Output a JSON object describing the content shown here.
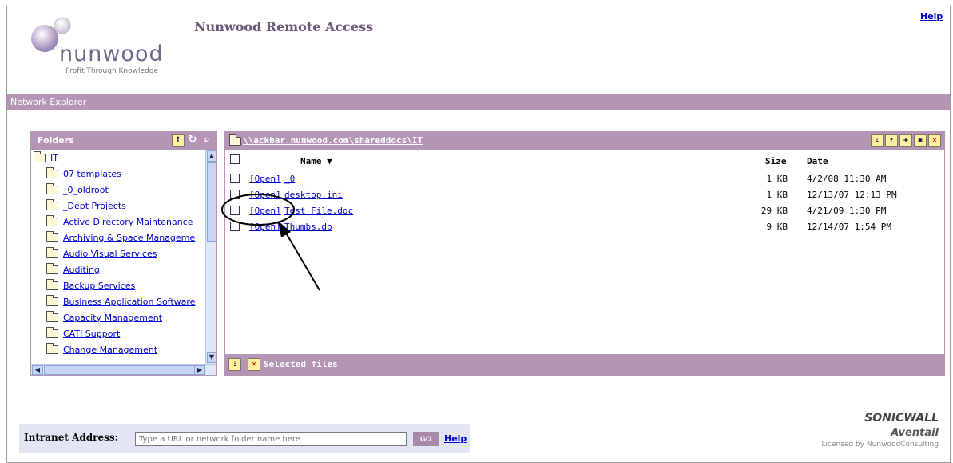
{
  "header": {
    "logo_name": "nunwood",
    "logo_tagline": "Profit Through Knowledge",
    "title": "Nunwood Remote Access",
    "help_link": "Help"
  },
  "section_bar": "Network Explorer",
  "folders_panel": {
    "title": "Folders",
    "root": "IT",
    "items": [
      "07 templates",
      "_0_oldroot",
      "_Dept Projects",
      "Active Directory Maintenance",
      "Archiving & Space Manageme",
      "Audio Visual Services",
      "Auditing",
      "Backup Services",
      "Business Application Software",
      "Capacity Management",
      "CATI Support",
      "Change Management"
    ]
  },
  "files_panel": {
    "path": "\\\\ackbar.nunwood.com\\shareddocs\\IT",
    "col_name": "Name ▼",
    "col_size": "Size",
    "col_date": "Date",
    "open_label": "[Open]",
    "rows": [
      {
        "name": "_0",
        "size": "1 KB",
        "date": "4/2/08 11:30 AM"
      },
      {
        "name": "desktop.ini",
        "size": "1 KB",
        "date": "12/13/07 12:13 PM"
      },
      {
        "name": "Test File.doc",
        "size": "29 KB",
        "date": "4/21/09 1:30 PM"
      },
      {
        "name": "Thumbs.db",
        "size": "9 KB",
        "date": "12/14/07 1:54 PM"
      }
    ],
    "footer_label": "Selected files"
  },
  "intranet": {
    "label": "Intranet Address:",
    "placeholder": "Type a URL or network folder name here",
    "go_label": "GO",
    "help_label": "Help"
  },
  "branding": {
    "sonicwall": "SONICWALL",
    "aventail": "Aventail",
    "licensed": "Licensed by NunwoodConsulting"
  },
  "colors": {
    "accent": "#b595b5",
    "link": "#0000cc",
    "title": "#6b5978"
  }
}
